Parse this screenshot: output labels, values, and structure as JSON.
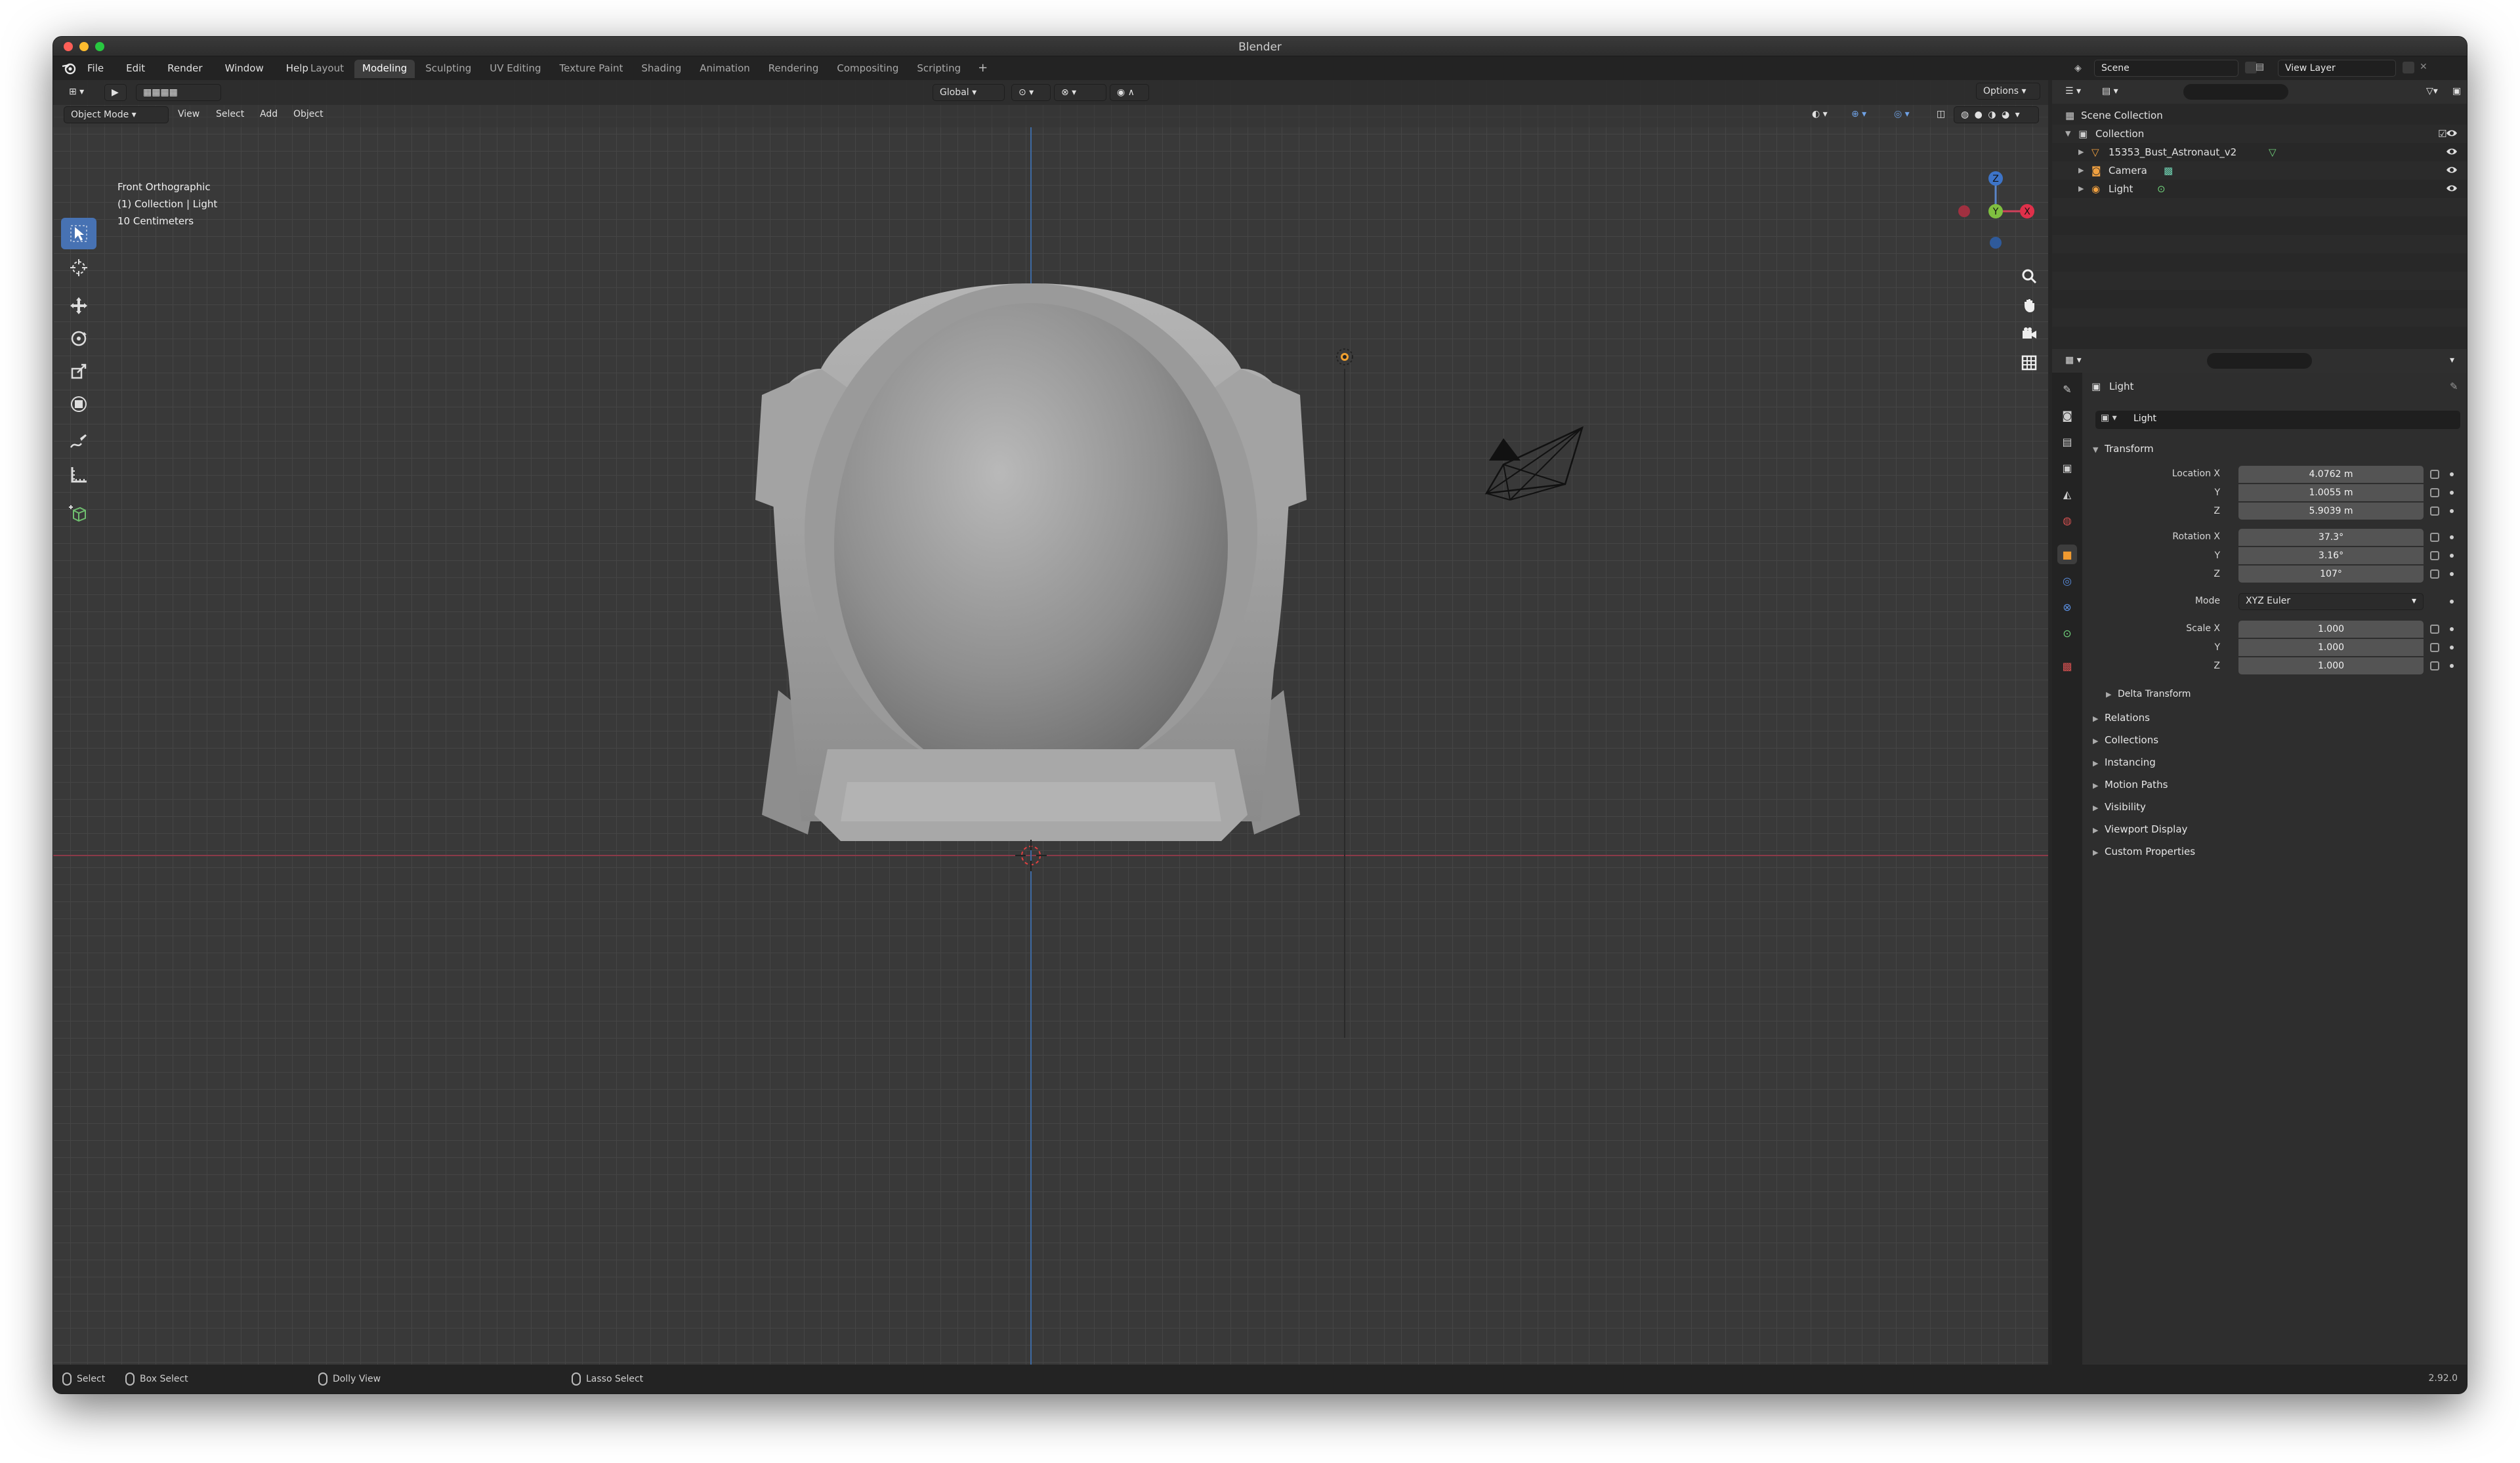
{
  "window": {
    "title": "Blender"
  },
  "menu": [
    "File",
    "Edit",
    "Render",
    "Window",
    "Help"
  ],
  "workspaces": [
    "Layout",
    "Modeling",
    "Sculpting",
    "UV Editing",
    "Texture Paint",
    "Shading",
    "Animation",
    "Rendering",
    "Compositing",
    "Scripting"
  ],
  "active_workspace": "Modeling",
  "scene": {
    "name": "Scene",
    "view_layer": "View Layer"
  },
  "viewport": {
    "mode": "Object Mode",
    "menus": [
      "View",
      "Select",
      "Add",
      "Object"
    ],
    "transform_orientation": "Global",
    "options_label": "Options",
    "overlay": {
      "view_name": "Front Orthographic",
      "collection": "(1) Collection | Light",
      "scale": "10 Centimeters"
    },
    "gizmo_axes": {
      "z": "Z",
      "y": "Y",
      "x": "X"
    }
  },
  "outliner": {
    "items": [
      {
        "label": "Scene Collection"
      },
      {
        "label": "Collection"
      },
      {
        "label": "15353_Bust_Astronaut_v2"
      },
      {
        "label": "Camera"
      },
      {
        "label": "Light"
      }
    ]
  },
  "properties": {
    "object_name": "Light",
    "data_name": "Light",
    "transform_label": "Transform",
    "location": {
      "label_x": "Location X",
      "x": "4.0762 m",
      "y": "1.0055 m",
      "z": "5.9039 m"
    },
    "rotation": {
      "label_x": "Rotation X",
      "x": "37.3°",
      "y": "3.16°",
      "z": "107°"
    },
    "mode_label": "Mode",
    "mode": "XYZ Euler",
    "scale": {
      "label_x": "Scale X",
      "x": "1.000",
      "y": "1.000",
      "z": "1.000"
    },
    "axis_y": "Y",
    "axis_z": "Z",
    "delta_transform": "Delta Transform",
    "panels": [
      "Relations",
      "Collections",
      "Instancing",
      "Motion Paths",
      "Visibility",
      "Viewport Display",
      "Custom Properties"
    ]
  },
  "statusbar": {
    "select": "Select",
    "box_select": "Box Select",
    "dolly_view": "Dolly View",
    "lasso_select": "Lasso Select",
    "version": "2.92.0"
  }
}
